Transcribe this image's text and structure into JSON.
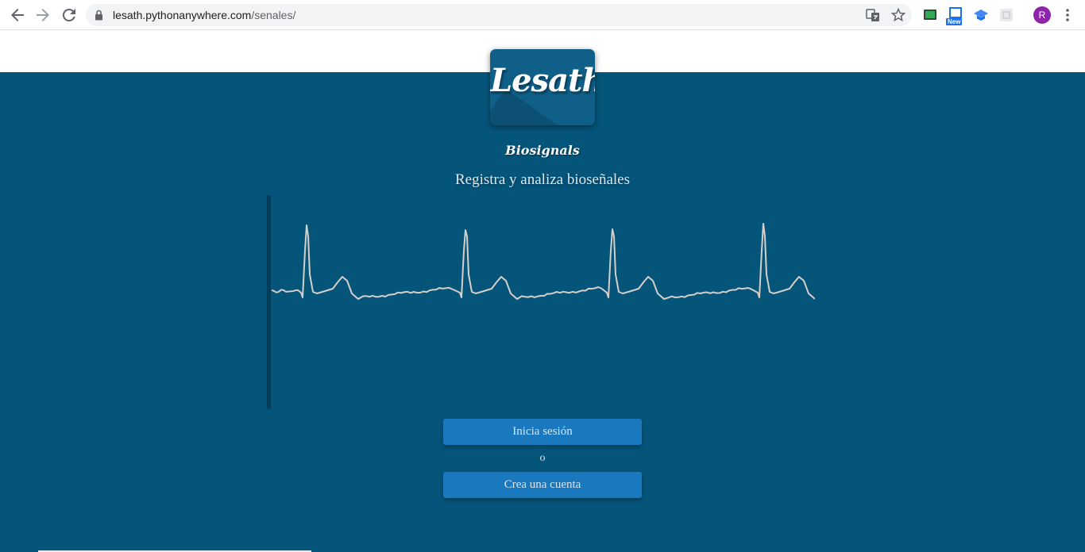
{
  "browser": {
    "url_host": "lesath.pythonanywhere.com",
    "url_path": "/senales/",
    "extension_badge": "New",
    "profile_initial": "R"
  },
  "page": {
    "logo_text": "Lesath",
    "brand": "Biosignals",
    "tagline": "Registra y analiza bioseñales",
    "login_label": "Inicia sesión",
    "or_text": "o",
    "signup_label": "Crea una cuenta"
  },
  "colors": {
    "background": "#05557b",
    "button": "#1a78be",
    "signal": "#d4cfc8"
  }
}
